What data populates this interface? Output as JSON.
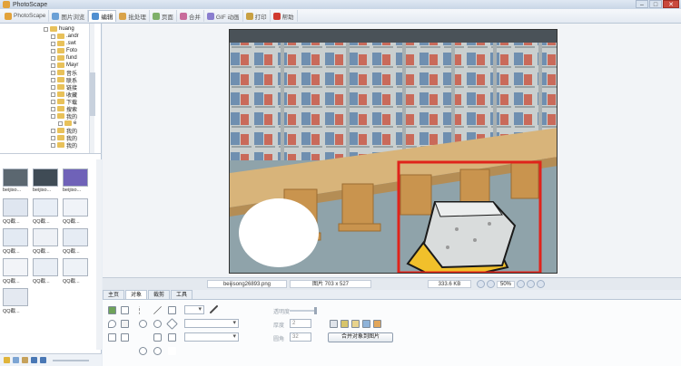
{
  "window": {
    "title": "PhotoScape",
    "minimize": "–",
    "maximize": "□",
    "close": "✕"
  },
  "tabs": [
    {
      "label": "PhotoScape",
      "icon": "photoscape-icon",
      "color": "#e2a23a"
    },
    {
      "label": "图片浏览",
      "icon": "viewer-icon",
      "color": "#6ba0d6"
    },
    {
      "label": "编辑",
      "icon": "editor-icon",
      "color": "#4f8fd1"
    },
    {
      "label": "批处理",
      "icon": "batch-icon",
      "color": "#d9a34a"
    },
    {
      "label": "页面",
      "icon": "page-icon",
      "color": "#7fb06a"
    },
    {
      "label": "合并",
      "icon": "combine-icon",
      "color": "#c86b9b"
    },
    {
      "label": "GIF 动画",
      "icon": "gif-icon",
      "color": "#8a7ecf"
    },
    {
      "label": "打印",
      "icon": "print-icon",
      "color": "#c8a043"
    },
    {
      "label": "帮助",
      "icon": "help-icon",
      "color": "#d03a2f"
    }
  ],
  "tree": {
    "items": [
      {
        "label": "huang",
        "level": 0
      },
      {
        "label": ".andr",
        "level": 1
      },
      {
        "label": ".swt",
        "level": 1
      },
      {
        "label": "Foto",
        "level": 1
      },
      {
        "label": "fund",
        "level": 1
      },
      {
        "label": "Mayr",
        "level": 1
      },
      {
        "label": "音乐",
        "level": 1
      },
      {
        "label": "联系",
        "level": 1
      },
      {
        "label": "链接",
        "level": 1
      },
      {
        "label": "收藏",
        "level": 1
      },
      {
        "label": "下载",
        "level": 1
      },
      {
        "label": "搜索",
        "level": 1
      },
      {
        "label": "我的",
        "level": 1
      },
      {
        "label": "e",
        "level": 2
      },
      {
        "label": "我的",
        "level": 1
      },
      {
        "label": "我的",
        "level": 1
      },
      {
        "label": "我的",
        "level": 1
      }
    ]
  },
  "thumbnails": [
    {
      "caption": "beijiso...",
      "color": "#5b6770"
    },
    {
      "caption": "beijiso...",
      "color": "#3f4b55"
    },
    {
      "caption": "beijiso...",
      "color": "#6f62b8"
    },
    {
      "caption": "QQ截...",
      "color": "#dfe6f0"
    },
    {
      "caption": "QQ截...",
      "color": "#e8eef6"
    },
    {
      "caption": "QQ截...",
      "color": "#f0f3f8"
    },
    {
      "caption": "QQ截...",
      "color": "#e3eaf3"
    },
    {
      "caption": "QQ截...",
      "color": "#eef1f6"
    },
    {
      "caption": "QQ截...",
      "color": "#e6ecf4"
    },
    {
      "caption": "QQ截...",
      "color": "#f2f4f8"
    },
    {
      "caption": "QQ截...",
      "color": "#e9eef5"
    },
    {
      "caption": "QQ截...",
      "color": "#eef2f7"
    },
    {
      "caption": "QQ截...",
      "color": "#e4e9f1"
    }
  ],
  "status": {
    "filename": "beijisong26893.png",
    "dimensions": "图片 703 x 527",
    "filesize": "333.6 KB",
    "zoom": "50%"
  },
  "tool_tabs": [
    "主页",
    "对象",
    "裁剪",
    "工具"
  ],
  "tools": {
    "transparency_label": "透明度",
    "thickness_label": "厚度",
    "radius_label": "圆角",
    "thickness_value": "2",
    "radius_value": "32",
    "merge_button": "合并对象到图片"
  }
}
